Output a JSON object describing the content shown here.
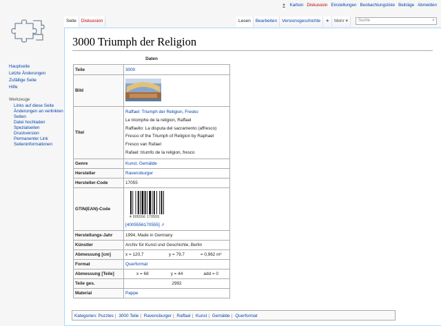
{
  "personal": {
    "user": "Karbon",
    "links": [
      "Diskussion",
      "Einstellungen",
      "Beobachtungsliste",
      "Beiträge",
      "Abmelden"
    ]
  },
  "tabs_left": [
    "Seite",
    "Diskussion"
  ],
  "tabs_right": [
    "Lesen",
    "Bearbeiten",
    "Versionsgeschichte"
  ],
  "more_label": "Mehr",
  "search": {
    "placeholder": "Suche"
  },
  "nav": {
    "items": [
      "Hauptseite",
      "Letzte Änderungen",
      "Zufällige Seite",
      "Hilfe"
    ],
    "tools_head": "Werkzeuge",
    "tools": [
      "Links auf diese Seite",
      "Änderungen an verlinkten Seiten",
      "Datei hochladen",
      "Spezialseiten",
      "Druckversion",
      "Permanenter Link",
      "Seiteninformationen"
    ]
  },
  "page": {
    "title": "3000 Triumph der Religion",
    "caption": "Daten",
    "rows": {
      "teile_k": "Teile",
      "teile_v": "3000",
      "bild_k": "Bild",
      "titel_k": "Titel",
      "titel_v": [
        "Raffael: Triumph der Religion, Fresko",
        "Le triomphe de la religion, Raffael",
        "Raffaello: La disputa del sacramento (affresco)",
        "Fresco of the Triumph of Religion by Raphael",
        "Fresco van Rafael",
        "Rafael: triumfo de la religion, fresco"
      ],
      "genre_k": "Genre",
      "genre_v": "Kunst, Gemälde",
      "hersteller_k": "Hersteller",
      "hersteller_v": "Ravensburger",
      "code_k": "Hersteller-Code",
      "code_v": "17055",
      "gtin_k": "GTIN(EAN)-Code",
      "gtin_digits": "4 005556 170555",
      "gtin_link": "[4005556170555]",
      "jahr_k": "Herstellungs-Jahr",
      "jahr_v": "1994, Made in Germany",
      "kuenstler_k": "Künstler",
      "kuenstler_v": "Archiv für Kunst und Geschichte, Berlin",
      "abm_k": "Abmessung [cm]",
      "abm_x": "x = 120,7",
      "abm_y": "y = 79,7",
      "abm_a": "= 0,962 m²",
      "format_k": "Format",
      "format_v": "Querformat",
      "abmt_k": "Abmessung [Teile]",
      "abmt_x": "x = 68",
      "abmt_y": "y = 44",
      "abmt_add": "add = 0",
      "ges_k": "Teile ges.",
      "ges_v": "2992",
      "material_k": "Material",
      "material_v": "Pappe"
    }
  },
  "categories": {
    "label": "Kategorien:",
    "items": [
      "Puzzles",
      "3000 Teile",
      "Ravensburger",
      "Raffael",
      "Kunst",
      "Gemälde",
      "Querformat"
    ]
  }
}
